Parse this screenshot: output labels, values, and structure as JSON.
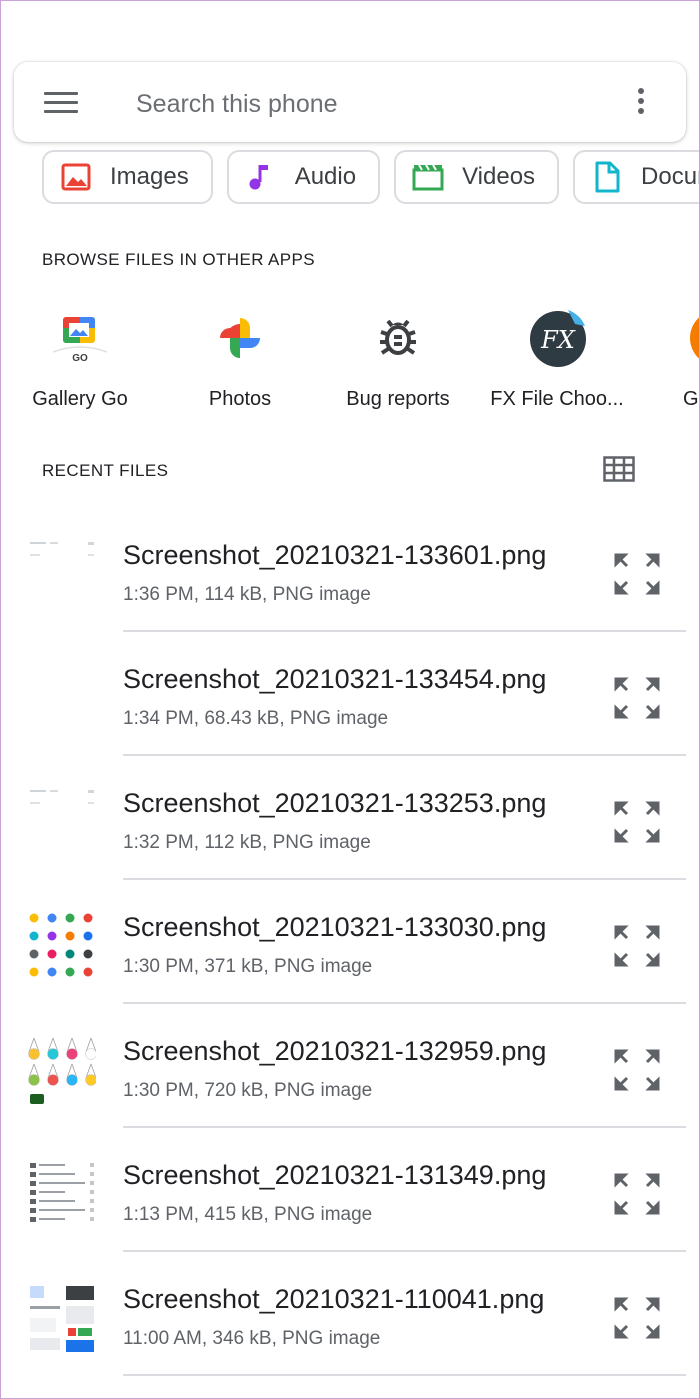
{
  "search": {
    "placeholder": "Search this phone"
  },
  "icons": {
    "menu": "menu-icon",
    "overflow": "more-vert-icon",
    "grid": "grid-view-icon",
    "expand": "expand-icon"
  },
  "categories": [
    {
      "label": "Images",
      "icon": "image-icon",
      "color": "#ea4335"
    },
    {
      "label": "Audio",
      "icon": "music-note-icon",
      "color": "#9334e6"
    },
    {
      "label": "Videos",
      "icon": "movie-icon",
      "color": "#34a853"
    },
    {
      "label": "Docur",
      "icon": "document-icon",
      "color": "#12b5cb"
    }
  ],
  "browse": {
    "title": "BROWSE FILES IN OTHER APPS",
    "apps": [
      {
        "label": "Gallery Go",
        "icon": "gallery-go-icon",
        "badge": "GO"
      },
      {
        "label": "Photos",
        "icon": "google-photos-icon"
      },
      {
        "label": "Bug reports",
        "icon": "bug-icon"
      },
      {
        "label": "FX File Choo...",
        "icon": "fx-file-explorer-icon",
        "badge": "FX"
      },
      {
        "label": "G",
        "icon": "partial-app-icon"
      }
    ]
  },
  "recent": {
    "title": "RECENT FILES",
    "files": [
      {
        "name": "Screenshot_20210321-133601.png",
        "meta": "1:36 PM, 114 kB, PNG image",
        "thumb": "sparse"
      },
      {
        "name": "Screenshot_20210321-133454.png",
        "meta": "1:34 PM, 68.43 kB, PNG image",
        "thumb": "none"
      },
      {
        "name": "Screenshot_20210321-133253.png",
        "meta": "1:32 PM, 112 kB, PNG image",
        "thumb": "sparse"
      },
      {
        "name": "Screenshot_20210321-133030.png",
        "meta": "1:30 PM, 371 kB, PNG image",
        "thumb": "icons"
      },
      {
        "name": "Screenshot_20210321-132959.png",
        "meta": "1:30 PM, 720 kB, PNG image",
        "thumb": "lamps"
      },
      {
        "name": "Screenshot_20210321-131349.png",
        "meta": "1:13 PM, 415 kB, PNG image",
        "thumb": "list"
      },
      {
        "name": "Screenshot_20210321-110041.png",
        "meta": "11:00 AM, 346 kB, PNG image",
        "thumb": "mixed"
      }
    ]
  }
}
